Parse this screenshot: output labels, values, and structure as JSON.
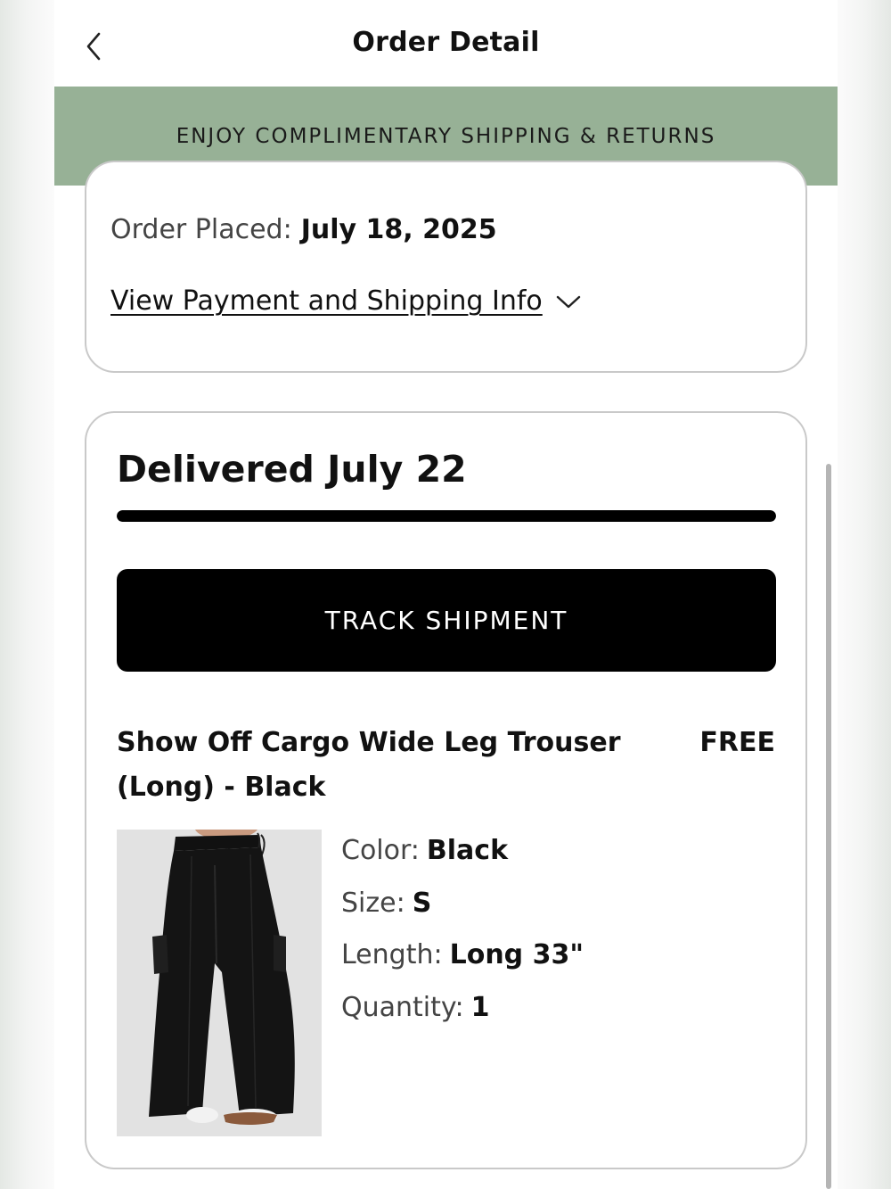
{
  "header": {
    "title": "Order Detail"
  },
  "banner": {
    "text": "ENJOY COMPLIMENTARY SHIPPING & RETURNS",
    "color": "#97b196"
  },
  "order": {
    "placed_label": "Order Placed:",
    "placed_date": "July 18, 2025",
    "payment_link": "View Payment and Shipping Info"
  },
  "shipment": {
    "status": "Delivered July 22",
    "progress_fraction": 1.0,
    "track_button": "TRACK SHIPMENT"
  },
  "item": {
    "name": "Show Off Cargo Wide Leg Trouser (Long) - Black",
    "price": "FREE",
    "attributes": [
      {
        "label": "Color:",
        "value": "Black"
      },
      {
        "label": "Size:",
        "value": "S"
      },
      {
        "label": "Length:",
        "value": "Long 33\""
      },
      {
        "label": "Quantity:",
        "value": "1"
      }
    ]
  }
}
